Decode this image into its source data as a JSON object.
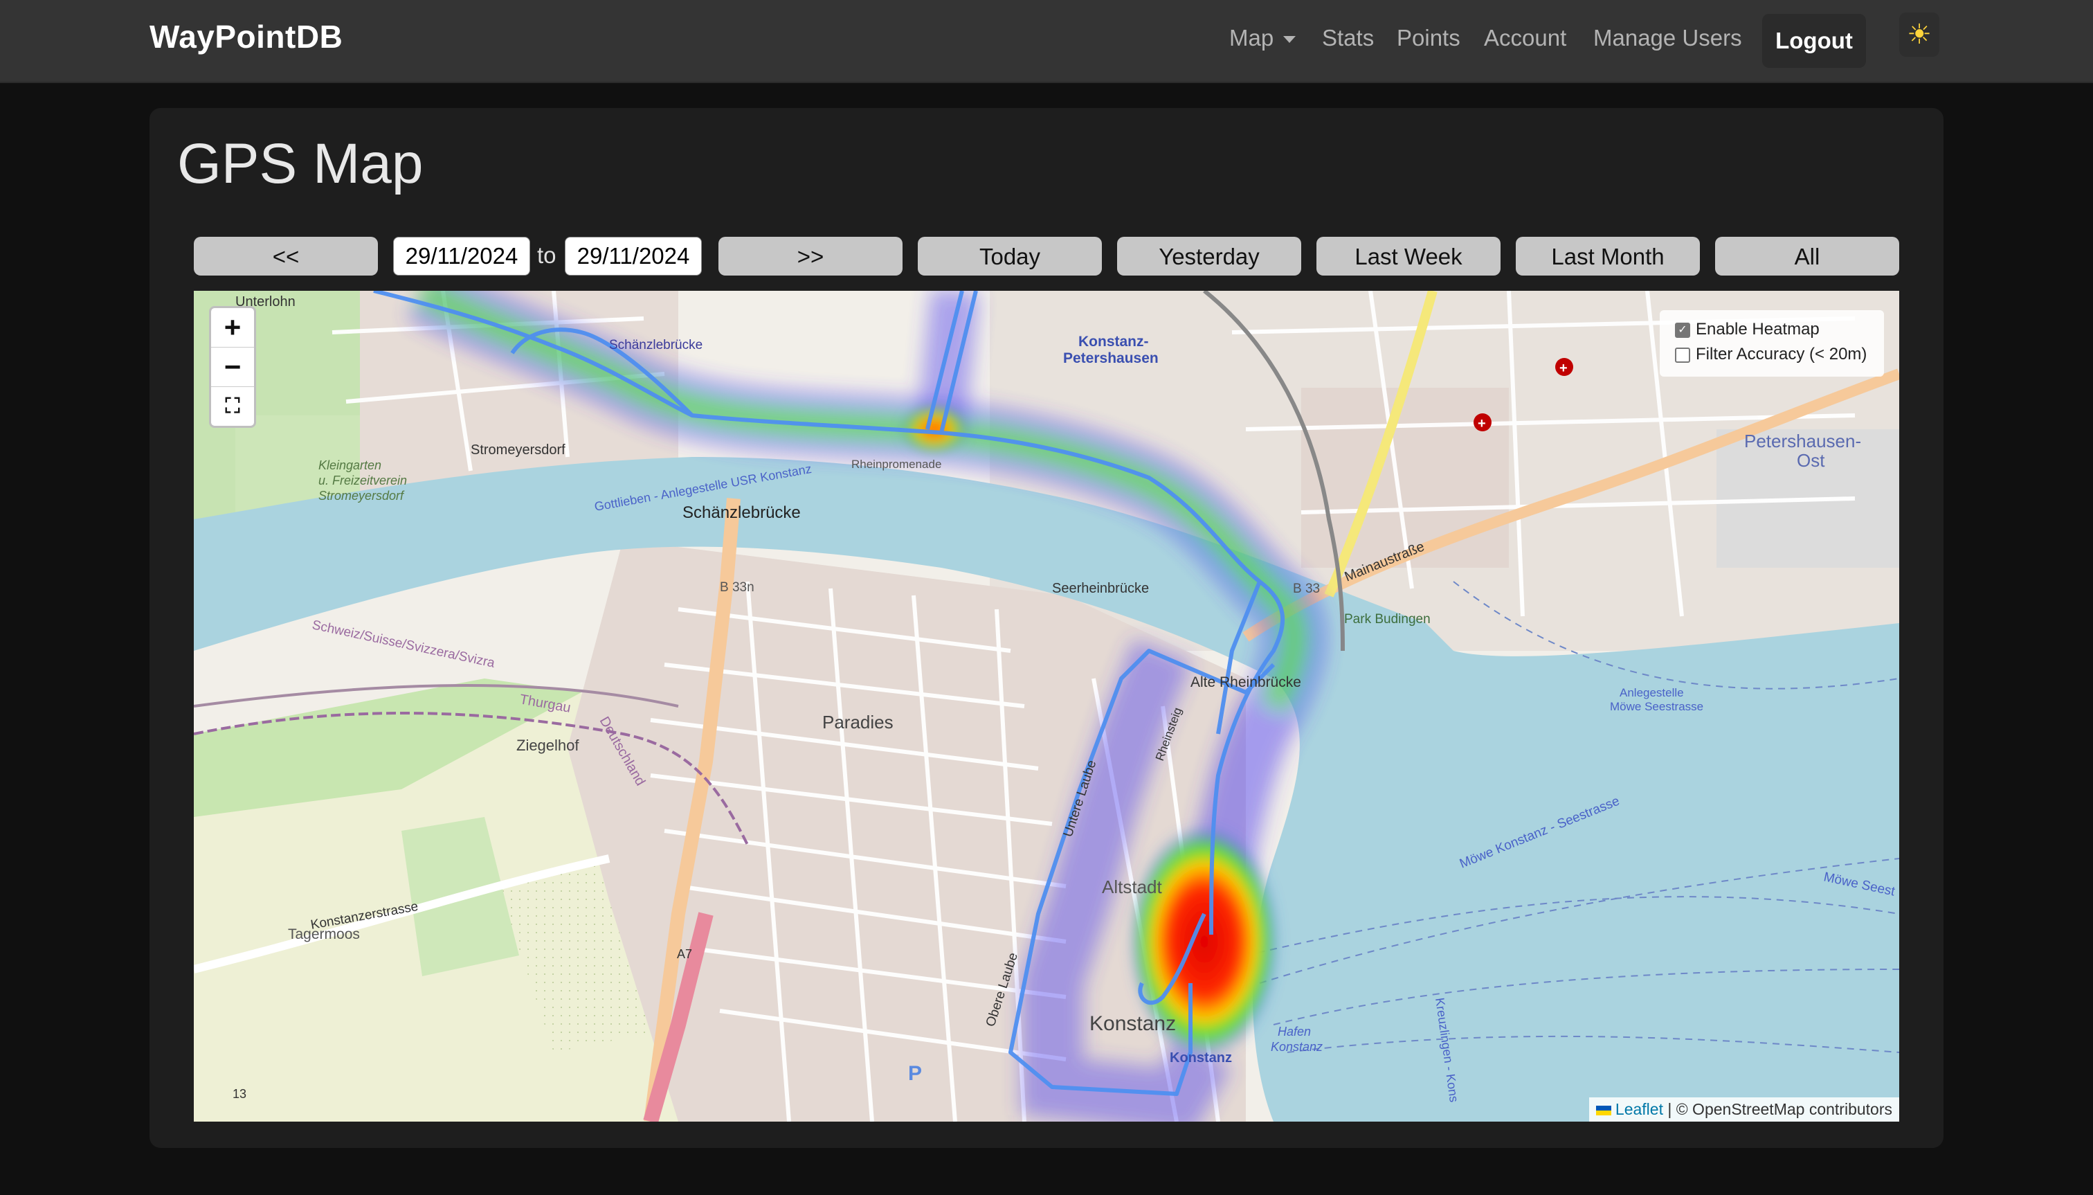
{
  "navbar": {
    "brand": "WayPointDB",
    "items": [
      {
        "label": "Map"
      },
      {
        "label": "Stats"
      },
      {
        "label": "Points"
      },
      {
        "label": "Account"
      },
      {
        "label": "Manage Users"
      }
    ],
    "logout_label": "Logout",
    "theme_icon": "☀"
  },
  "page": {
    "title": "GPS Map"
  },
  "controls": {
    "prev_label": "<<",
    "date_from": "29/11/2024",
    "to_label": "to",
    "date_to": "29/11/2024",
    "next_label": ">>",
    "today_label": "Today",
    "yesterday_label": "Yesterday",
    "last_week_label": "Last Week",
    "last_month_label": "Last Month",
    "all_label": "All"
  },
  "map": {
    "zoom_in": "+",
    "zoom_out": "−",
    "fullscreen_icon": "⛶",
    "heatmap_label": "Enable Heatmap",
    "heatmap_enabled": true,
    "accuracy_label": "Filter Accuracy (< 20m)",
    "accuracy_enabled": false,
    "attribution_leaflet": "Leaflet",
    "attribution_rest": "| © OpenStreetMap contributors",
    "labels": {
      "unterlohn": "Unterlohn",
      "schaenzlebruecke_small": "Schänzlebrücke",
      "stromeyersdorf": "Stromeyersdorf",
      "kleingarten": "Kleingarten",
      "freizeitverein": "u. Freizeitverein",
      "stromeyersdorf2": "Stromeyersdorf",
      "anlegestelle_usr": "Gottlieben - Anlegestelle USR Konstanz",
      "schaenzlebruecke": "Schänzlebrücke",
      "b33n": "B 33n",
      "rheinpromenade": "Rheinpromenade",
      "konstanz_petershausen": "Konstanz-",
      "petershausen": "Petershausen",
      "petershausen_ost": "Petershausen-",
      "ost": "Ost",
      "seerheinbruecke": "Seerheinbrücke",
      "b33": "B 33",
      "mainaustrasse": "Mainaustraße",
      "park_budingen": "Park Budingen",
      "alte_rheinbruecke": "Alte Rheinbrücke",
      "paradies": "Paradies",
      "ziegelhof": "Ziegelhof",
      "deutschland": "Deutschland",
      "thurgau": "Thurgau",
      "schweiz": "Schweiz/Suisse/Svizzera/Svizra",
      "konstanzerstrasse": "Konstanzerstrasse",
      "tagermoos": "Tagermoos",
      "altstadt": "Altstadt",
      "konstanz": "Konstanz",
      "konstanz_station": "Konstanz",
      "a7": "A7",
      "n13": "13",
      "anlegestelle_moewe": "Anlegestelle",
      "moewe_seestrasse": "Möwe Seestrasse",
      "moewe_konstanz": "Möwe Konstanz - Seestrasse",
      "moewe_seest": "Möwe Seest",
      "kreuzlingen": "Kreuzlingen - Kons",
      "hafen": "Hafen",
      "hafen2": "Konstanz",
      "untere_laube": "Untere Laube",
      "obere_laube": "Obere Laube",
      "rheinsteig": "Rheinsteig",
      "p_label": "P"
    }
  }
}
